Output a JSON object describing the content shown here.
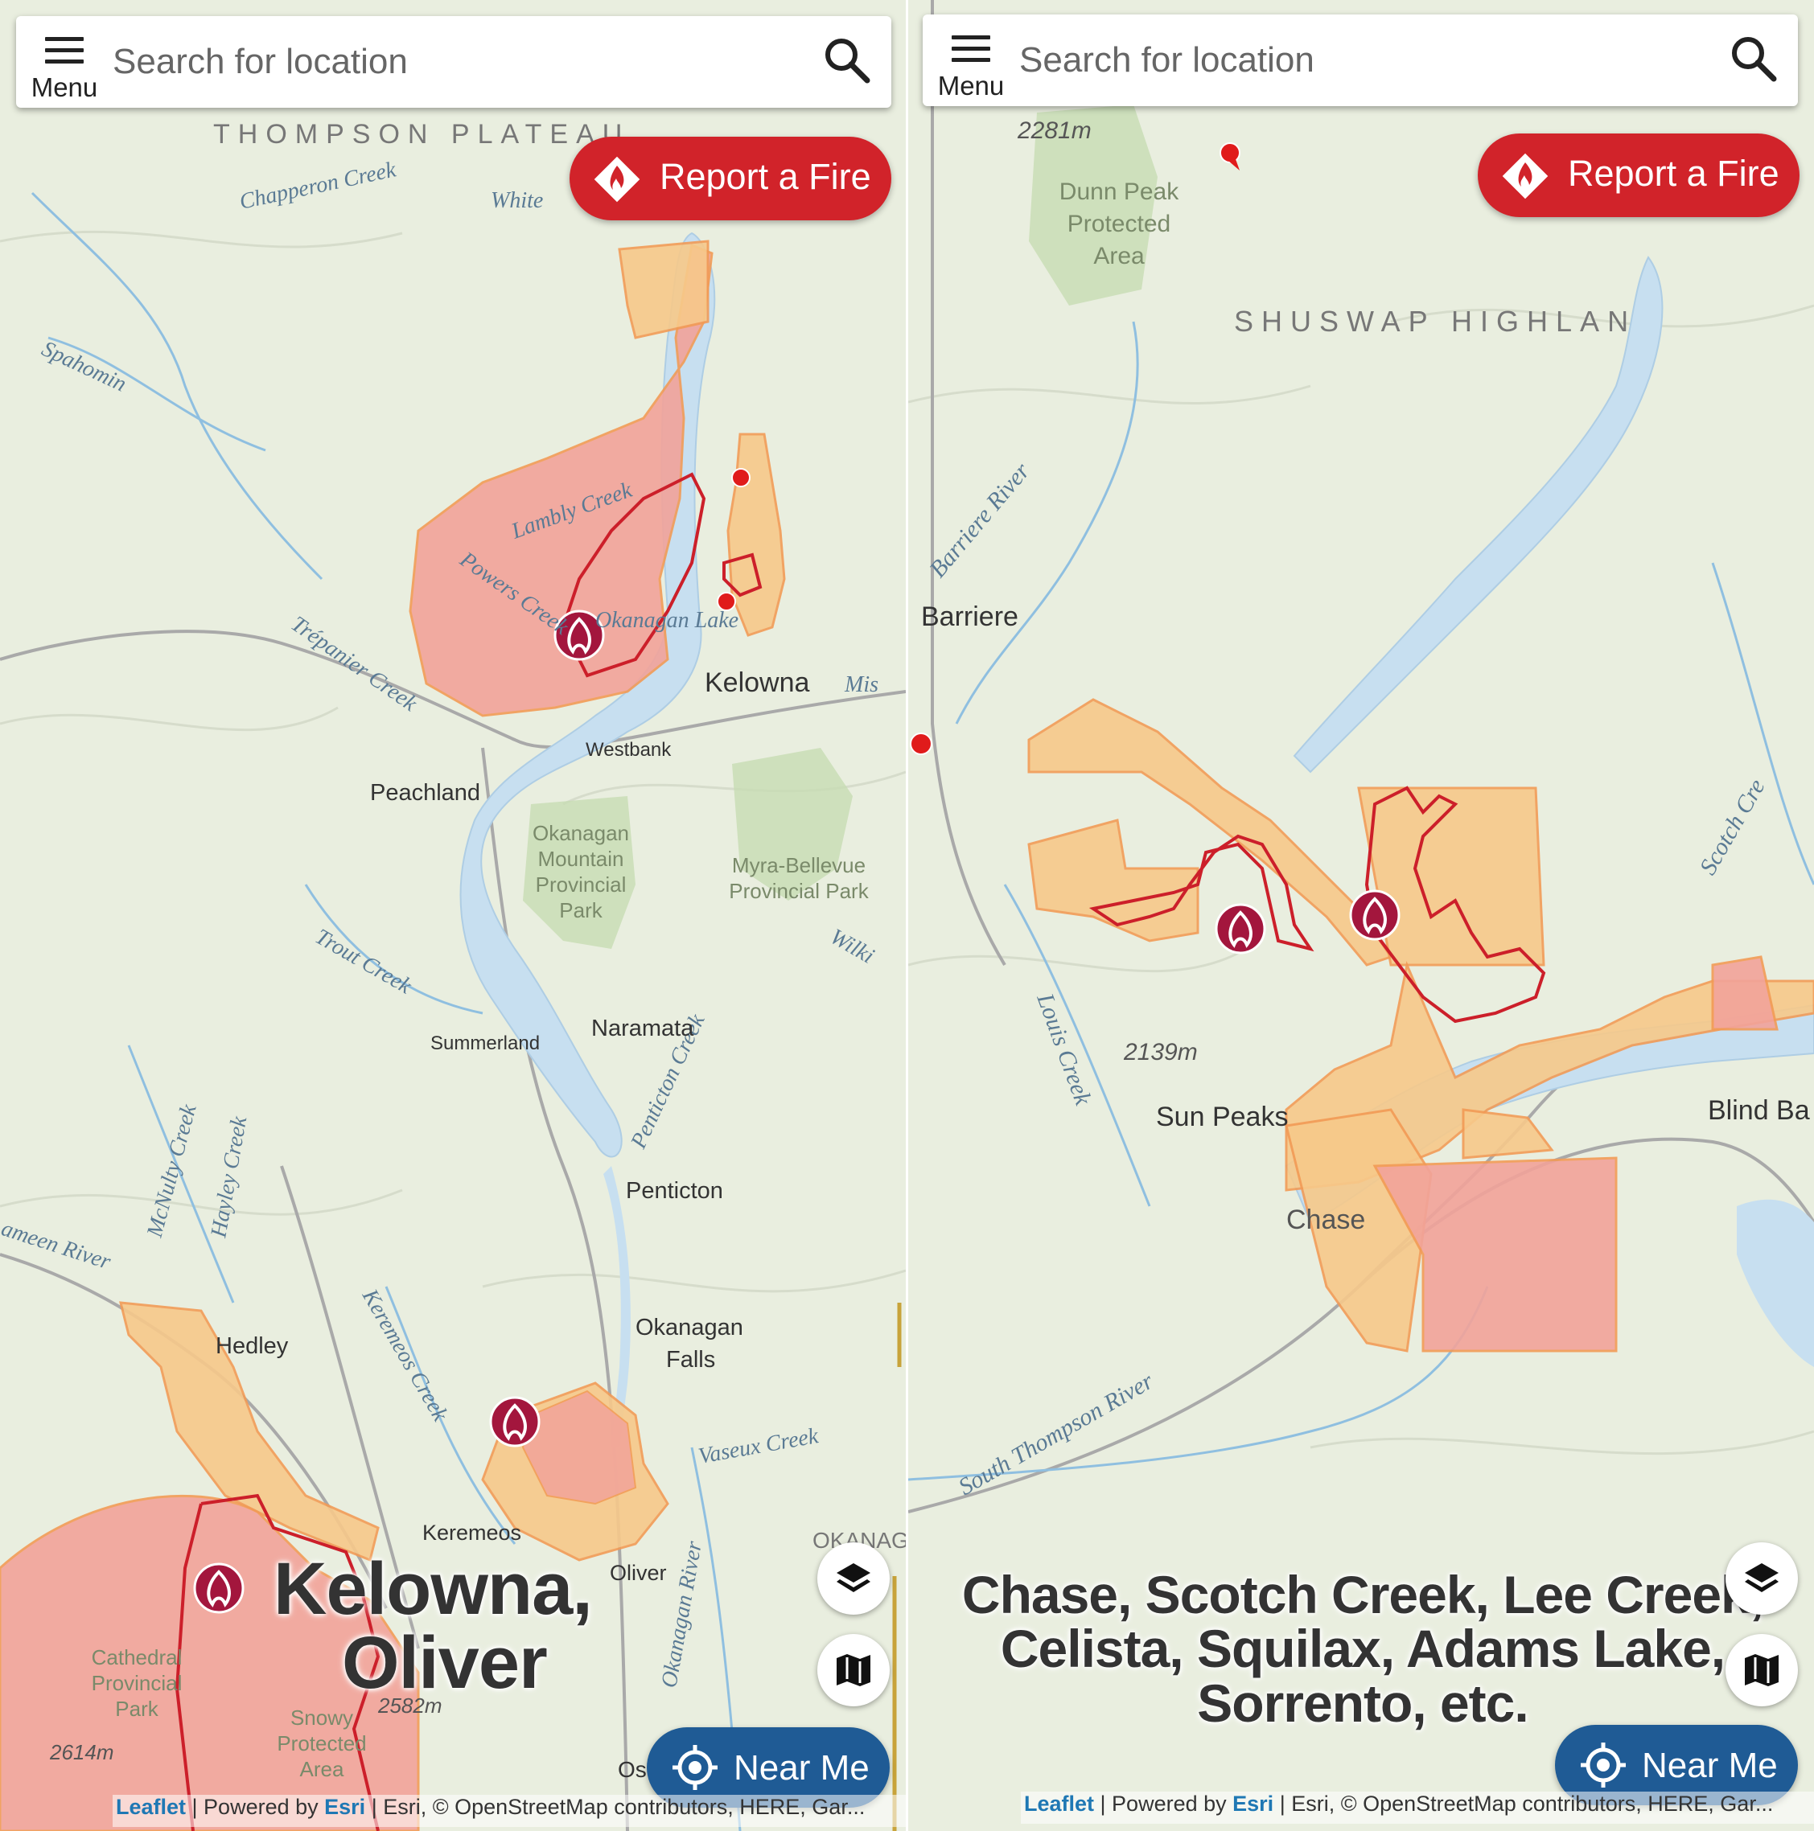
{
  "left": {
    "menu_label": "Menu",
    "search_placeholder": "Search for location",
    "report_fire_label": "Report a Fire",
    "near_me_label": "Near Me",
    "attribution": {
      "leaflet": "Leaflet",
      "powered_by": " | Powered by ",
      "esri": "Esri",
      "rest": " | Esri, © OpenStreetMap contributors, HERE, Gar..."
    },
    "overlay_caption": [
      "Kelowna,",
      "Oliver"
    ],
    "map_labels": {
      "thompson_plateau": "THOMPSON  PLATEAU",
      "chapperon_creek": "Chapperon Creek",
      "whiteman": "White",
      "spahomin_creek": "Spahomin",
      "lambly_creek": "Lambly Creek",
      "powers_creek": "Powers Creek",
      "okanagan_lake": "Okanagan Lake",
      "trepanier_creek": "Trépanier Creek",
      "kelowna": "Kelowna",
      "westbank": "Westbank",
      "peachland": "Peachland",
      "okanagan_mountain_park": [
        "Okanagan",
        "Mountain",
        "Provincial",
        "Park"
      ],
      "myra_bellevue_park": [
        "Myra-Bellevue",
        "Provincial Park"
      ],
      "trout_creek": "Trout Creek",
      "summerland": "Summerland",
      "naramata": "Naramata",
      "penticton_creek": "Penticton Creek",
      "mcnulty_creek": "McNulty Creek",
      "hayley_creek": "Hayley Creek",
      "penticton": "Penticton",
      "okanagan_falls": [
        "Okanagan",
        "Falls"
      ],
      "hedley": "Hedley",
      "keremeos_creek": "Keremeos Creek",
      "vaseux_creek": "Vaseux Creek",
      "keremeos": "Keremeos",
      "oliver": "Oliver",
      "okanagan_river": "Okanagan River",
      "cathedral_park": [
        "Cathedral",
        "Provincial",
        "Park"
      ],
      "snowy_area": [
        "Snowy",
        "Protected",
        "Area"
      ],
      "elev_2582": "2582m",
      "elev_2614": "2614m",
      "okanagan_edge": "OKANAG",
      "os": "Os",
      "wilkinson": "Wilki",
      "mission": "Mis",
      "similkameen": "ameen River"
    },
    "fire_markers": 4
  },
  "right": {
    "menu_label": "Menu",
    "search_placeholder": "Search for location",
    "report_fire_label": "Report a Fire",
    "near_me_label": "Near Me",
    "attribution": {
      "leaflet": "Leaflet",
      "powered_by": " | Powered by ",
      "esri": "Esri",
      "rest": " | Esri, © OpenStreetMap contributors, HERE, Gar..."
    },
    "overlay_caption": [
      "Chase, Scotch Creek, Lee Creek,",
      "Celista, Squilax, Adams Lake,",
      "Sorrento, etc."
    ],
    "map_labels": {
      "elev_2281": "2281m",
      "dunn_peak": [
        "Dunn Peak",
        "Protected",
        "Area"
      ],
      "shuswap_highland": "SHUSWAP  HIGHLAN",
      "barriere_river": "Barriere River",
      "barriere": "Barriere",
      "scotch_creek": "Scotch Cre",
      "louis_creek": "Louis Creek",
      "elev_2139": "2139m",
      "sun_peaks": "Sun Peaks",
      "blind_bay": "Blind Ba",
      "chase": "Chase",
      "south_thompson_river": "South Thompson River"
    },
    "fire_markers": 2
  },
  "colors": {
    "map_bg": "#e9eedf",
    "water": "#c7dff0",
    "fire_red": "#d1232a",
    "perimeter": "#cc1f2a",
    "fire_area_fill": "#f2a39a",
    "evac_order_fill": "#f7c98a",
    "near_me_blue": "#1f5b95",
    "park_green": "#c7dcb3"
  }
}
